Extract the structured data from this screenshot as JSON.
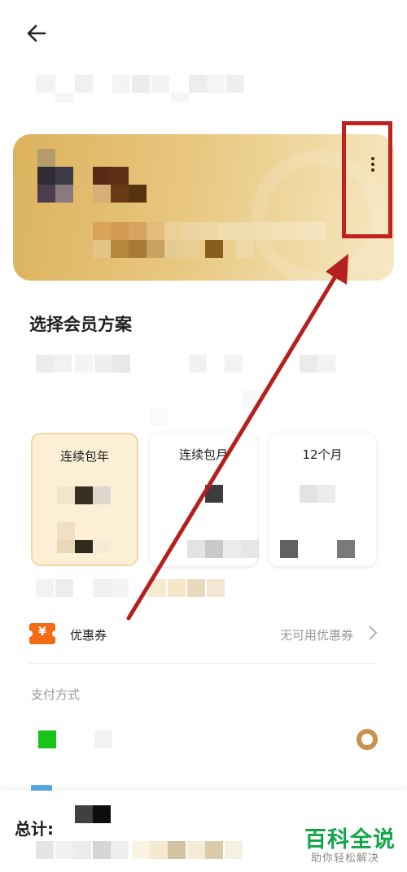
{
  "header": {
    "back_icon": "arrow-left-icon"
  },
  "card": {
    "more_icon": "more-vertical-icon"
  },
  "plans": {
    "section_title": "选择会员方案",
    "items": [
      {
        "name": "连续包年",
        "selected": true
      },
      {
        "name": "连续包月",
        "selected": false
      },
      {
        "name": "12个月",
        "selected": false
      }
    ]
  },
  "coupon": {
    "icon": "yen-coupon-icon",
    "label": "优惠券",
    "status": "无可用优惠券"
  },
  "payment": {
    "title": "支付方式"
  },
  "footer": {
    "total_label": "总计:"
  },
  "watermark": {
    "main": "百科全说",
    "sub": "助你轻松解决"
  },
  "colors": {
    "accent": "#c1221f",
    "gold": "#e3bf74",
    "coupon": "#f36b12",
    "wechat": "#17c417",
    "watermark": "#12a64b"
  }
}
